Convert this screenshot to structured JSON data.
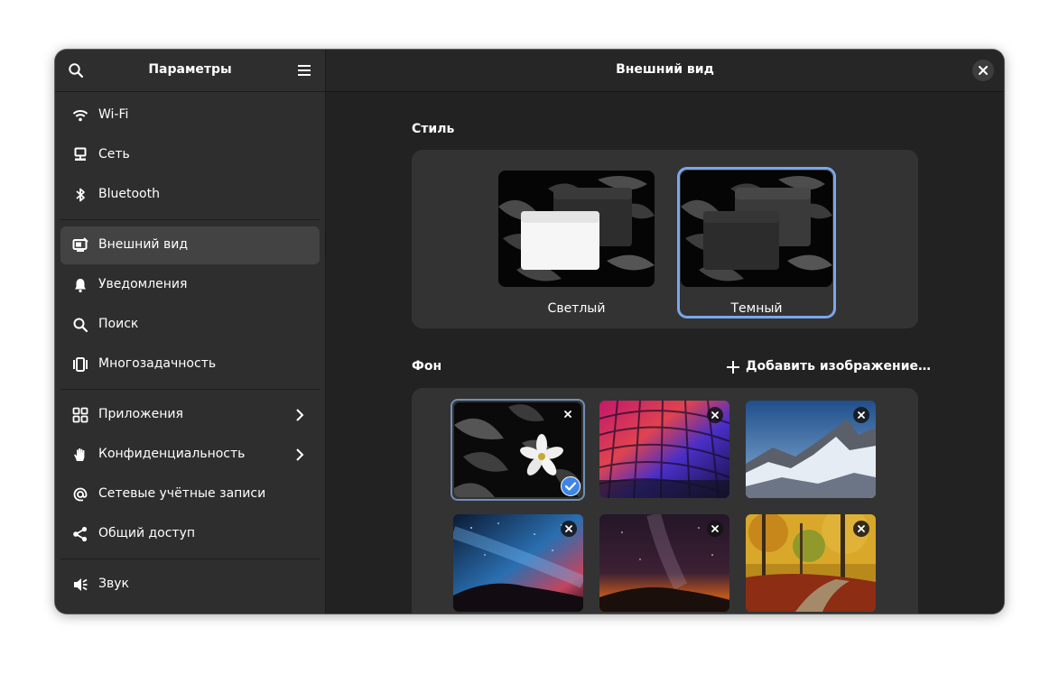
{
  "sidebar": {
    "title": "Параметры",
    "search_icon": "search-icon",
    "menu_icon": "hamburger-menu-icon",
    "items": [
      {
        "label": "Wi-Fi",
        "icon": "wifi-icon"
      },
      {
        "label": "Сеть",
        "icon": "network-icon"
      },
      {
        "label": "Bluetooth",
        "icon": "bluetooth-icon"
      },
      {
        "label": "Внешний вид",
        "icon": "appearance-icon",
        "active": true
      },
      {
        "label": "Уведомления",
        "icon": "bell-icon"
      },
      {
        "label": "Поиск",
        "icon": "search-icon"
      },
      {
        "label": "Многозадачность",
        "icon": "multitasking-icon"
      },
      {
        "label": "Приложения",
        "icon": "apps-icon",
        "chevron": true
      },
      {
        "label": "Конфиденциальность",
        "icon": "hand-icon",
        "chevron": true
      },
      {
        "label": "Сетевые учётные записи",
        "icon": "at-icon"
      },
      {
        "label": "Общий доступ",
        "icon": "share-icon"
      },
      {
        "label": "Звук",
        "icon": "speaker-icon"
      }
    ]
  },
  "main": {
    "title": "Внешний вид",
    "close_icon": "close-icon",
    "style_section": {
      "title": "Стиль",
      "options": [
        {
          "label": "Светлый",
          "selected": false
        },
        {
          "label": "Темный",
          "selected": true
        }
      ]
    },
    "background_section": {
      "title": "Фон",
      "add_label": "Добавить изображение…",
      "wallpapers": [
        {
          "name": "flower",
          "selected": true
        },
        {
          "name": "colorful-cobblestones",
          "selected": false
        },
        {
          "name": "mountains",
          "selected": false
        },
        {
          "name": "milky-way-blue",
          "selected": false
        },
        {
          "name": "milky-way-orange",
          "selected": false
        },
        {
          "name": "autumn-forest",
          "selected": false
        }
      ]
    }
  },
  "colors": {
    "accent": "#3f85e6",
    "selection_ring": "#7aa7ea",
    "sidebar_bg": "#2e2e2e",
    "content_bg": "#222222",
    "card_bg": "#333333"
  }
}
